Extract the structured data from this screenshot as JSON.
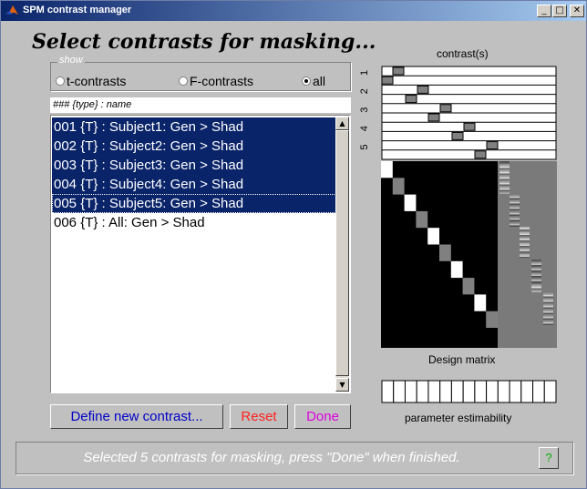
{
  "window": {
    "title": "SPM contrast manager",
    "controls": [
      "minimize",
      "maximize",
      "close"
    ]
  },
  "heading": "Select contrasts for masking...",
  "show": {
    "legend": "show",
    "options": [
      {
        "label": "t-contrasts",
        "selected": false
      },
      {
        "label": "F-contrasts",
        "selected": false
      },
      {
        "label": "all",
        "selected": true
      }
    ]
  },
  "list": {
    "header": "### {type} : name",
    "items": [
      {
        "text": "001 {T} : Subject1: Gen > Shad",
        "selected": true
      },
      {
        "text": "002 {T} : Subject2: Gen > Shad",
        "selected": true
      },
      {
        "text": "003 {T} : Subject3: Gen > Shad",
        "selected": true
      },
      {
        "text": "004 {T} : Subject4: Gen > Shad",
        "selected": true
      },
      {
        "text": "005 {T} : Subject5: Gen > Shad",
        "selected": true,
        "focused": true
      },
      {
        "text": "006 {T} : All: Gen > Shad",
        "selected": false
      }
    ]
  },
  "buttons": {
    "define": "Define new contrast...",
    "reset": "Reset",
    "done": "Done",
    "help": "?"
  },
  "colors": {
    "define": "#0000c8",
    "reset": "#ff2020",
    "done": "#e000e0",
    "selection": "#0a246a",
    "help": "#00b000"
  },
  "contrast_panel": {
    "title": "contrast(s)",
    "row_labels": [
      "1",
      "2",
      "3",
      "4",
      "5"
    ]
  },
  "design_matrix": {
    "label": "Design matrix"
  },
  "estimability": {
    "label": "parameter estimability",
    "cells": 15
  },
  "status": "Selected 5 contrasts for masking, press \"Done\" when finished."
}
